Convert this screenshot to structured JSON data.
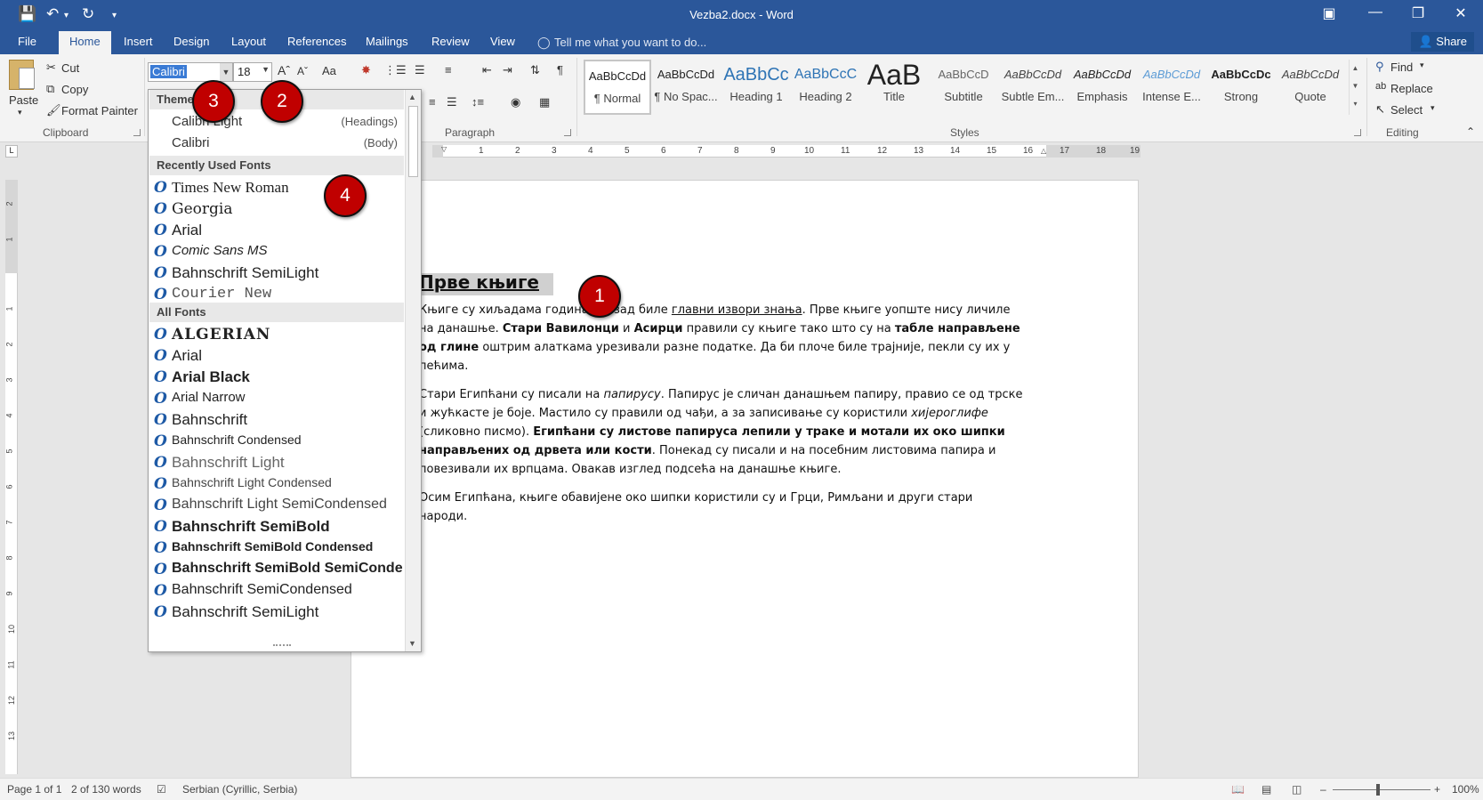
{
  "window": {
    "title": "Vezba2.docx - Word",
    "quick_access": [
      "save-icon",
      "undo-icon",
      "redo-icon",
      "customize-icon"
    ],
    "controls": [
      "ribbon-display-icon",
      "minimize-icon",
      "restore-icon",
      "close-icon"
    ]
  },
  "tabs": [
    {
      "label": "File"
    },
    {
      "label": "Home"
    },
    {
      "label": "Insert"
    },
    {
      "label": "Design"
    },
    {
      "label": "Layout"
    },
    {
      "label": "References"
    },
    {
      "label": "Mailings"
    },
    {
      "label": "Review"
    },
    {
      "label": "View"
    }
  ],
  "tell_me": "Tell me what you want to do...",
  "share": "Share",
  "clipboard": {
    "paste": "Paste",
    "cut": "Cut",
    "copy": "Copy",
    "format_painter": "Format Painter",
    "label": "Clipboard"
  },
  "font": {
    "name": "Calibri",
    "size": "18",
    "change_case": "Aa"
  },
  "paragraph": {
    "label": "Paragraph"
  },
  "styles": {
    "label": "Styles",
    "items": [
      {
        "sample": "AaBbCcDd",
        "name": "¶ Normal"
      },
      {
        "sample": "AaBbCcDd",
        "name": "¶ No Spac..."
      },
      {
        "sample": "AaBbCc",
        "name": "Heading 1"
      },
      {
        "sample": "AaBbCcC",
        "name": "Heading 2"
      },
      {
        "sample": "AaB",
        "name": "Title"
      },
      {
        "sample": "AaBbCcD",
        "name": "Subtitle"
      },
      {
        "sample": "AaBbCcDd",
        "name": "Subtle Em..."
      },
      {
        "sample": "AaBbCcDd",
        "name": "Emphasis"
      },
      {
        "sample": "AaBbCcDd",
        "name": "Intense E..."
      },
      {
        "sample": "AaBbCcDc",
        "name": "Strong"
      },
      {
        "sample": "AaBbCcDd",
        "name": "Quote"
      }
    ]
  },
  "editing": {
    "find": "Find",
    "replace": "Replace",
    "select": "Select",
    "label": "Editing"
  },
  "font_dropdown": {
    "theme_header": "Theme Fonts",
    "theme_fonts": [
      {
        "name": "Calibri Light",
        "role": "(Headings)"
      },
      {
        "name": "Calibri",
        "role": "(Body)"
      }
    ],
    "recent_header": "Recently Used Fonts",
    "recent_fonts": [
      "Times New Roman",
      "Georgia",
      "Arial",
      "Comic Sans MS",
      "Bahnschrift SemiLight",
      "Courier New"
    ],
    "all_header": "All Fonts",
    "all_fonts": [
      "ALGERIAN",
      "Arial",
      "Arial Black",
      "Arial Narrow",
      "Bahnschrift",
      "Bahnschrift Condensed",
      "Bahnschrift Light",
      "Bahnschrift Light Condensed",
      "Bahnschrift Light SemiCondensed",
      "Bahnschrift SemiBold",
      "Bahnschrift SemiBold Condensed",
      "Bahnschrift SemiBold SemiConden",
      "Bahnschrift SemiCondensed",
      "Bahnschrift SemiLight"
    ],
    "font_icon_glyph": "O"
  },
  "ruler": {
    "h_ticks": [
      "1",
      "2",
      "3",
      "4",
      "5",
      "6",
      "7",
      "8",
      "9",
      "10",
      "11",
      "12",
      "13",
      "14",
      "15",
      "16",
      "17",
      "18",
      "19"
    ],
    "v_ticks": [
      "2",
      "1",
      "1",
      "2",
      "3",
      "4",
      "5",
      "6",
      "7",
      "8",
      "9",
      "10",
      "11",
      "12",
      "13"
    ],
    "corner": "L"
  },
  "document": {
    "heading": "Прве књиге",
    "paragraphs": [
      [
        {
          "t": "Књиге су хиљадама година уназад биле "
        },
        {
          "t": "главни извори знања",
          "u": true
        },
        {
          "t": ". Прве књиге уопште нису личиле на данашње. "
        },
        {
          "t": "Стари Вавилонци",
          "b": true
        },
        {
          "t": " и "
        },
        {
          "t": "Асирци",
          "b": true
        },
        {
          "t": " правили су књиге тако што су на "
        },
        {
          "t": "табле направљене од глине",
          "b": true
        },
        {
          "t": " оштрим алаткама урезивали разне податке. Да би плоче биле трајније, пекли су их у пећима."
        }
      ],
      [
        {
          "t": "Стари Египћани су писали на "
        },
        {
          "t": "папирусу",
          "i": true
        },
        {
          "t": ". Папирус је сличан данашњем папиру, правио се од трске и жућкасте је боје. Мастило су правили од чађи, а за записивање су користили "
        },
        {
          "t": "хијероглифе",
          "i": true
        },
        {
          "t": " (сликовно писмо). "
        },
        {
          "t": "Египћани су листове папируса лепили у траке и мотали их око шипки направљених од дрвета или кости",
          "b": true
        },
        {
          "t": ". Понекад су писали и на посебним листовима папира и повезивали их врпцама. Овакав изглед подсећа на данашње књиге."
        }
      ],
      [
        {
          "t": "Осим Египћана, књиге обавијене око шипки користили су и Грци, Римљани и други стари народи."
        }
      ]
    ]
  },
  "markers": [
    "1",
    "2",
    "3",
    "4"
  ],
  "status": {
    "page": "Page 1 of 1",
    "words": "2 of 130 words",
    "language": "Serbian (Cyrillic, Serbia)",
    "zoom": "100%",
    "zoom_level": 1.0,
    "zoom_minus": "–",
    "zoom_plus": "+"
  },
  "colors": {
    "brand": "#2b579a",
    "marker": "#c00000",
    "selection": "#3a7bd5",
    "font_icon": "#1e5aa6",
    "heading2_style": "#2e74b5"
  }
}
